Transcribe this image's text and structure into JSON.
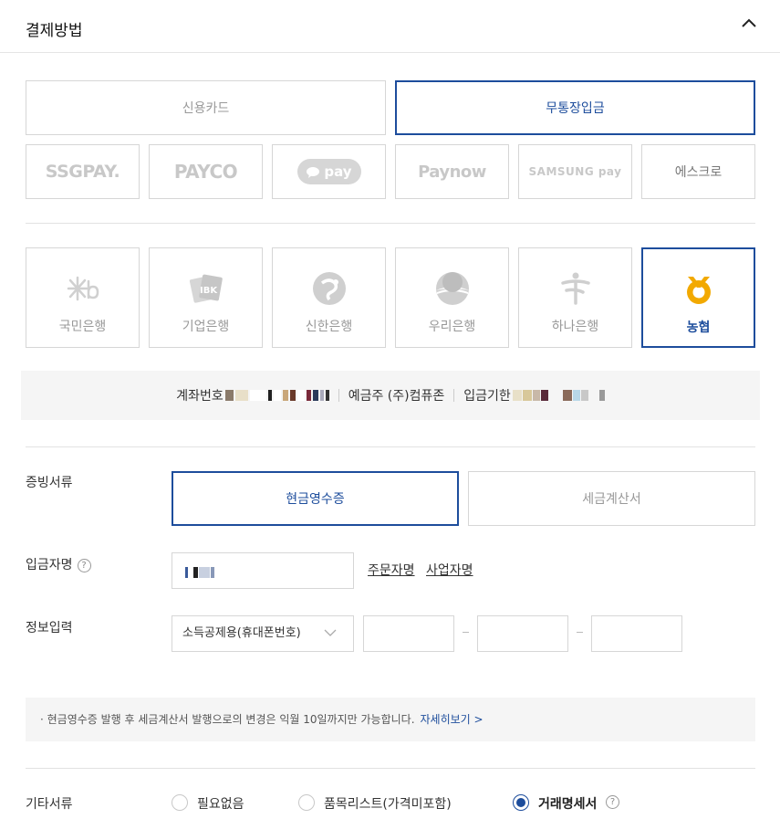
{
  "header": {
    "title": "결제방법"
  },
  "payment_methods": {
    "credit_card": "신용카드",
    "bank_transfer": "무통장입금"
  },
  "easy_pay": {
    "ssgpay": "SSGPAY.",
    "payco": "PAYCO",
    "kakaopay": "pay",
    "paynow": "Paynow",
    "samsungpay": "SAMSUNG pay",
    "escrow": "에스크로"
  },
  "banks": {
    "kb": "국민은행",
    "ibk": "기업은행",
    "shinhan": "신한은행",
    "woori": "우리은행",
    "hana": "하나은행",
    "nh": "농협"
  },
  "account": {
    "number_label": "계좌번호",
    "holder": "예금주 (주)컴퓨존",
    "deadline_label": "입금기한"
  },
  "receipt": {
    "label": "증빙서류",
    "cash_receipt": "현금영수증",
    "tax_invoice": "세금계산서"
  },
  "depositor": {
    "label": "입금자명",
    "help": "?",
    "order_name": "주문자명",
    "business_name": "사업자명"
  },
  "info": {
    "label": "정보입력",
    "select_value": "소득공제용(휴대폰번호)"
  },
  "notice": {
    "text": "·  현금영수증 발행 후 세금계산서 발행으로의 변경은 익월 10일까지만 가능합니다.",
    "more": "자세히보기 >"
  },
  "other_docs": {
    "label": "기타서류",
    "none": "필요없음",
    "item_list": "품목리스트(가격미포함)",
    "statement": "거래명세서",
    "help": "?",
    "selected": "statement"
  },
  "colors": {
    "accent": "#1d4d9c",
    "nh_yellow": "#f2a900"
  }
}
